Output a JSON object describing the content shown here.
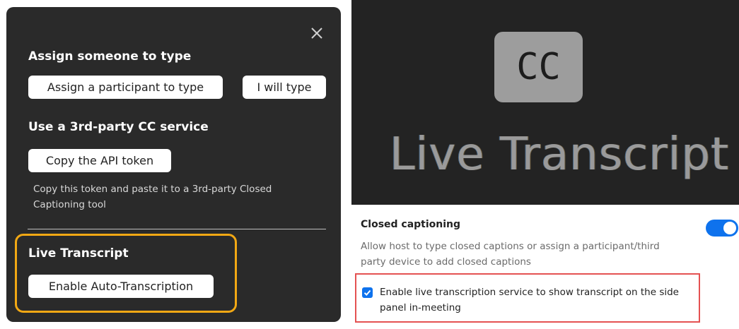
{
  "cc_panel": {
    "assign_heading": "Assign someone to type",
    "assign_participant_button": "Assign a participant to type",
    "i_will_type_button": "I will type",
    "third_party_heading": "Use a 3rd-party CC service",
    "copy_api_button": "Copy the API token",
    "copy_api_helper": "Copy this token and paste it to a 3rd-party Closed Captioning tool",
    "live_transcript_heading": "Live Transcript",
    "enable_auto_button": "Enable Auto-Transcription",
    "close_icon": "close-icon",
    "highlight_color": "#f2a814"
  },
  "graphic": {
    "cc_label": "CC",
    "title": "Live Transcript"
  },
  "settings": {
    "closed_captioning_title": "Closed captioning",
    "closed_captioning_desc": "Allow host to type closed captions or assign a participant/third party device to add closed captions",
    "toggle_on": true,
    "live_transcription_checkbox_label": "Enable live transcription service to show transcript on the side panel in-meeting",
    "checkbox_checked": true,
    "highlight_color": "#e45252",
    "accent_color": "#0e72ed"
  }
}
